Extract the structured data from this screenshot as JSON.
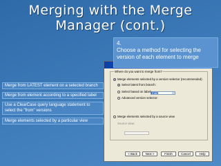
{
  "slide": {
    "title_line1": "Merging with the Merge",
    "title_line2": "Manager (cont.)"
  },
  "callout": {
    "step": "4.",
    "text": "Choose a method for selecting the version of each element to merge"
  },
  "labels": [
    "Merge from LATEST element on a selected branch",
    "Merge from element according to a specified label",
    "Use a ClearCase query language statement to select the \"from\" versions",
    "Merge elements selected by a particular view"
  ],
  "dialog": {
    "group_label": "Where do you want to merge from?",
    "option_versions": "Merge elements selected by a version selector (recommended)",
    "option_latest": "Select latest from branch:",
    "branch_value": "main",
    "option_label": "Select based on label:",
    "option_advanced": "Advanced version selector:",
    "option_view": "Merge elements selected by a source view",
    "source_view_label": "Source view:",
    "buttons": [
      "< Back",
      "Next >",
      "Finish",
      "Cancel",
      "Help"
    ]
  }
}
